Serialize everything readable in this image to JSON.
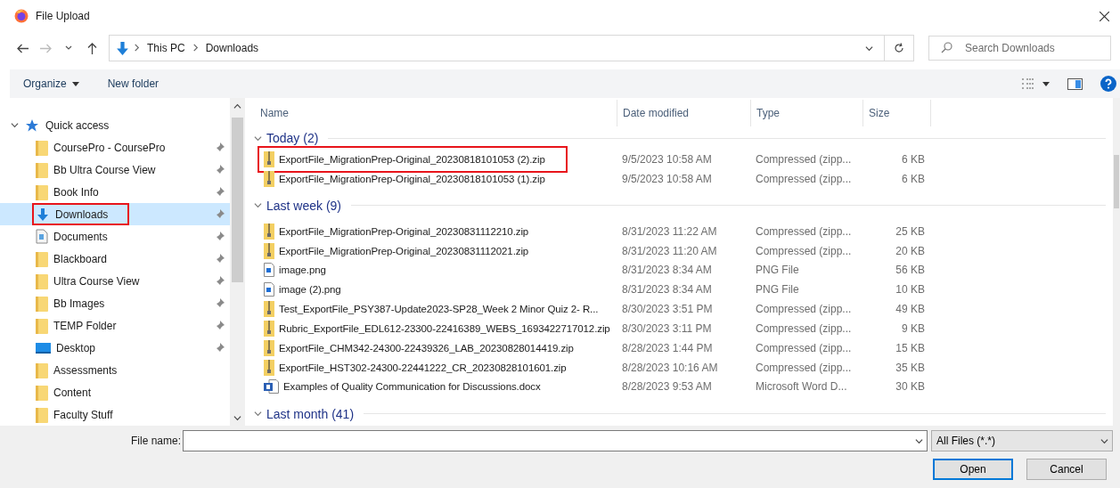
{
  "window": {
    "title": "File Upload"
  },
  "address": {
    "path": [
      "This PC",
      "Downloads"
    ],
    "search_placeholder": "Search Downloads"
  },
  "toolbar": {
    "organize": "Organize",
    "new_folder": "New folder"
  },
  "sidebar": {
    "header": {
      "label": "Quick access",
      "expanded": true
    },
    "items": [
      {
        "label": "CoursePro - CoursePro",
        "kind": "folder",
        "pinned": true,
        "selected": false,
        "annotated": false
      },
      {
        "label": "Bb Ultra Course View",
        "kind": "folder",
        "pinned": true,
        "selected": false,
        "annotated": false
      },
      {
        "label": "Book Info",
        "kind": "folder",
        "pinned": true,
        "selected": false,
        "annotated": false
      },
      {
        "label": "Downloads",
        "kind": "downloads",
        "pinned": true,
        "selected": true,
        "annotated": true
      },
      {
        "label": "Documents",
        "kind": "documents",
        "pinned": true,
        "selected": false,
        "annotated": false
      },
      {
        "label": "Blackboard",
        "kind": "folder",
        "pinned": true,
        "selected": false,
        "annotated": false
      },
      {
        "label": "Ultra Course View",
        "kind": "folder",
        "pinned": true,
        "selected": false,
        "annotated": false
      },
      {
        "label": "Bb Images",
        "kind": "folder",
        "pinned": true,
        "selected": false,
        "annotated": false
      },
      {
        "label": "TEMP Folder",
        "kind": "folder",
        "pinned": true,
        "selected": false,
        "annotated": false
      },
      {
        "label": "Desktop",
        "kind": "desktop",
        "pinned": true,
        "selected": false,
        "annotated": false
      },
      {
        "label": "Assessments",
        "kind": "folder",
        "pinned": false,
        "selected": false,
        "annotated": false
      },
      {
        "label": "Content",
        "kind": "folder",
        "pinned": false,
        "selected": false,
        "annotated": false
      },
      {
        "label": "Faculty Stuff",
        "kind": "folder",
        "pinned": false,
        "selected": false,
        "annotated": false
      }
    ]
  },
  "table": {
    "columns": [
      "Name",
      "Date modified",
      "Type",
      "Size"
    ],
    "groups": [
      {
        "label": "Today (2)",
        "expanded": true,
        "rows": [
          {
            "name": "ExportFile_MigrationPrep-Original_20230818101053 (2).zip",
            "kind": "zip",
            "date": "9/5/2023 10:58 AM",
            "type": "Compressed (zipp...",
            "size": "6 KB",
            "annotated": true
          },
          {
            "name": "ExportFile_MigrationPrep-Original_20230818101053 (1).zip",
            "kind": "zip",
            "date": "9/5/2023 10:58 AM",
            "type": "Compressed (zipp...",
            "size": "6 KB",
            "annotated": false
          }
        ]
      },
      {
        "label": "Last week (9)",
        "expanded": true,
        "rows": [
          {
            "name": "ExportFile_MigrationPrep-Original_20230831112210.zip",
            "kind": "zip",
            "date": "8/31/2023 11:22 AM",
            "type": "Compressed (zipp...",
            "size": "25 KB",
            "annotated": false
          },
          {
            "name": "ExportFile_MigrationPrep-Original_20230831112021.zip",
            "kind": "zip",
            "date": "8/31/2023 11:20 AM",
            "type": "Compressed (zipp...",
            "size": "20 KB",
            "annotated": false
          },
          {
            "name": "image.png",
            "kind": "png",
            "date": "8/31/2023 8:34 AM",
            "type": "PNG File",
            "size": "56 KB",
            "annotated": false
          },
          {
            "name": "image (2).png",
            "kind": "png",
            "date": "8/31/2023 8:34 AM",
            "type": "PNG File",
            "size": "10 KB",
            "annotated": false
          },
          {
            "name": "Test_ExportFile_PSY387-Update2023-SP28_Week 2 Minor Quiz 2- R...",
            "kind": "zip",
            "date": "8/30/2023 3:51 PM",
            "type": "Compressed (zipp...",
            "size": "49 KB",
            "annotated": false
          },
          {
            "name": "Rubric_ExportFile_EDL612-23300-22416389_WEBS_1693422717012.zip",
            "kind": "zip",
            "date": "8/30/2023 3:11 PM",
            "type": "Compressed (zipp...",
            "size": "9 KB",
            "annotated": false
          },
          {
            "name": "ExportFile_CHM342-24300-22439326_LAB_20230828014419.zip",
            "kind": "zip",
            "date": "8/28/2023 1:44 PM",
            "type": "Compressed (zipp...",
            "size": "15 KB",
            "annotated": false
          },
          {
            "name": "ExportFile_HST302-24300-22441222_CR_20230828101601.zip",
            "kind": "zip",
            "date": "8/28/2023 10:16 AM",
            "type": "Compressed (zipp...",
            "size": "35 KB",
            "annotated": false
          },
          {
            "name": "Examples of Quality Communication for Discussions.docx",
            "kind": "docx",
            "date": "8/28/2023 9:53 AM",
            "type": "Microsoft Word D...",
            "size": "30 KB",
            "annotated": false
          }
        ]
      },
      {
        "label": "Last month (41)",
        "expanded": true
      }
    ]
  },
  "footer": {
    "file_name_label": "File name:",
    "filter": "All Files (*.*)",
    "buttons": [
      "Open",
      "Cancel"
    ]
  }
}
